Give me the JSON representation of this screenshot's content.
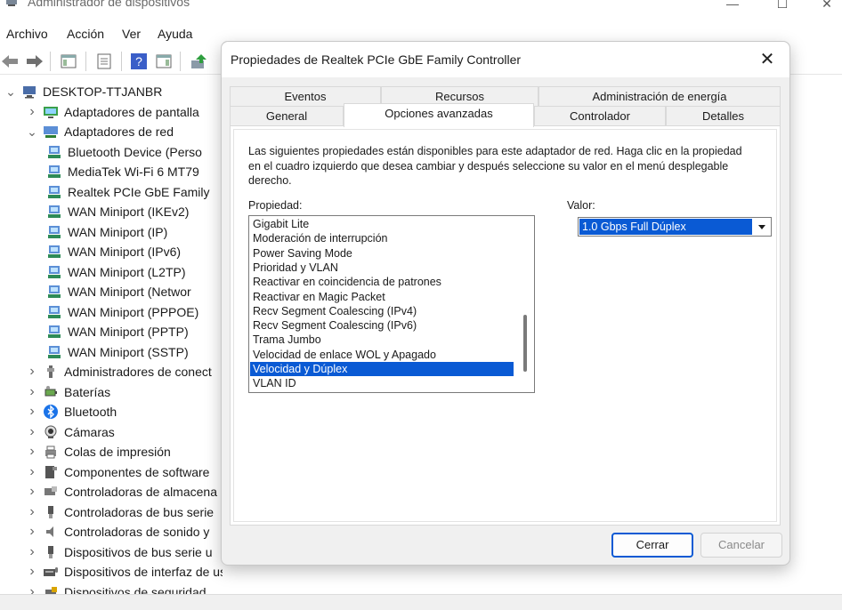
{
  "window": {
    "title": "Administrador de dispositivos",
    "controls": {
      "minimize": "—",
      "maximize": "☐",
      "close": "✕"
    }
  },
  "menu": [
    "Archivo",
    "Acción",
    "Ver",
    "Ayuda"
  ],
  "toolbar_icons": [
    "back-arrow-icon",
    "forward-arrow-icon",
    "show-hide-console-tree-icon",
    "properties-icon",
    "help-icon",
    "action-pane-icon",
    "update-driver-icon"
  ],
  "tree": {
    "root": "DESKTOP-TTJANBR",
    "items": [
      {
        "label": "Adaptadores de pantalla",
        "level": 1,
        "expander": "collapsed",
        "icon": "display-adapter-icon"
      },
      {
        "label": "Adaptadores de red",
        "level": 1,
        "expander": "expanded",
        "icon": "network-adapter-icon"
      },
      {
        "label": "Bluetooth Device (Perso",
        "level": 2,
        "icon": "network-card-icon"
      },
      {
        "label": "MediaTek Wi-Fi 6 MT79",
        "level": 2,
        "icon": "network-card-icon"
      },
      {
        "label": "Realtek PCIe GbE Family",
        "level": 2,
        "icon": "network-card-icon"
      },
      {
        "label": "WAN Miniport (IKEv2)",
        "level": 2,
        "icon": "network-card-icon"
      },
      {
        "label": "WAN Miniport (IP)",
        "level": 2,
        "icon": "network-card-icon"
      },
      {
        "label": "WAN Miniport (IPv6)",
        "level": 2,
        "icon": "network-card-icon"
      },
      {
        "label": "WAN Miniport (L2TP)",
        "level": 2,
        "icon": "network-card-icon"
      },
      {
        "label": "WAN Miniport (Networ",
        "level": 2,
        "icon": "network-card-icon"
      },
      {
        "label": "WAN Miniport (PPPOE)",
        "level": 2,
        "icon": "network-card-icon"
      },
      {
        "label": "WAN Miniport (PPTP)",
        "level": 2,
        "icon": "network-card-icon"
      },
      {
        "label": "WAN Miniport (SSTP)",
        "level": 2,
        "icon": "network-card-icon"
      },
      {
        "label": "Administradores de conect",
        "level": 1,
        "expander": "collapsed",
        "icon": "connector-icon"
      },
      {
        "label": "Baterías",
        "level": 1,
        "expander": "collapsed",
        "icon": "battery-icon"
      },
      {
        "label": "Bluetooth",
        "level": 1,
        "expander": "collapsed",
        "icon": "bluetooth-icon"
      },
      {
        "label": "Cámaras",
        "level": 1,
        "expander": "collapsed",
        "icon": "camera-icon"
      },
      {
        "label": "Colas de impresión",
        "level": 1,
        "expander": "collapsed",
        "icon": "printer-icon"
      },
      {
        "label": "Componentes de software",
        "level": 1,
        "expander": "collapsed",
        "icon": "software-component-icon"
      },
      {
        "label": "Controladoras de almacena",
        "level": 1,
        "expander": "collapsed",
        "icon": "storage-controller-icon"
      },
      {
        "label": "Controladoras de bus serie",
        "level": 1,
        "expander": "collapsed",
        "icon": "usb-icon"
      },
      {
        "label": "Controladoras de sonido y",
        "level": 1,
        "expander": "collapsed",
        "icon": "speaker-icon"
      },
      {
        "label": "Dispositivos de bus serie u",
        "level": 1,
        "expander": "collapsed",
        "icon": "usb-icon"
      },
      {
        "label": "Dispositivos de interfaz de usuario (HID)",
        "level": 1,
        "expander": "collapsed",
        "icon": "hid-icon"
      },
      {
        "label": "Dispositivos de seguridad",
        "level": 1,
        "expander": "collapsed",
        "icon": "security-device-icon"
      }
    ]
  },
  "dialog": {
    "title": "Propiedades de Realtek PCIe GbE Family Controller",
    "close": "✕",
    "tabs_row1": [
      "Eventos",
      "Recursos",
      "Administración de energía"
    ],
    "tabs_row2": [
      "General",
      "Opciones avanzadas",
      "Controlador",
      "Detalles"
    ],
    "active_tab": "Opciones avanzadas",
    "description": "Las siguientes propiedades están disponibles para este adaptador de red. Haga clic en la propiedad en el cuadro izquierdo que desea cambiar y después seleccione su valor en el menú desplegable derecho.",
    "property_label": "Propiedad:",
    "value_label": "Valor:",
    "properties": [
      "Gigabit Lite",
      "Moderación de interrupción",
      "Power Saving Mode",
      "Prioridad y VLAN",
      "Reactivar en coincidencia de patrones",
      "Reactivar en Magic Packet",
      "Recv Segment Coalescing (IPv4)",
      "Recv Segment Coalescing (IPv6)",
      "Trama Jumbo",
      "Velocidad de enlace WOL y Apagado",
      "Velocidad y Dúplex",
      "VLAN ID"
    ],
    "selected_property": "Velocidad y Dúplex",
    "value": "1.0 Gbps Full Dúplex",
    "buttons": {
      "close": "Cerrar",
      "cancel": "Cancelar"
    }
  },
  "colors": {
    "selection": "#0a5ad4",
    "dialog_bg": "#f0f0f0",
    "panel_bg": "#ffffff"
  }
}
